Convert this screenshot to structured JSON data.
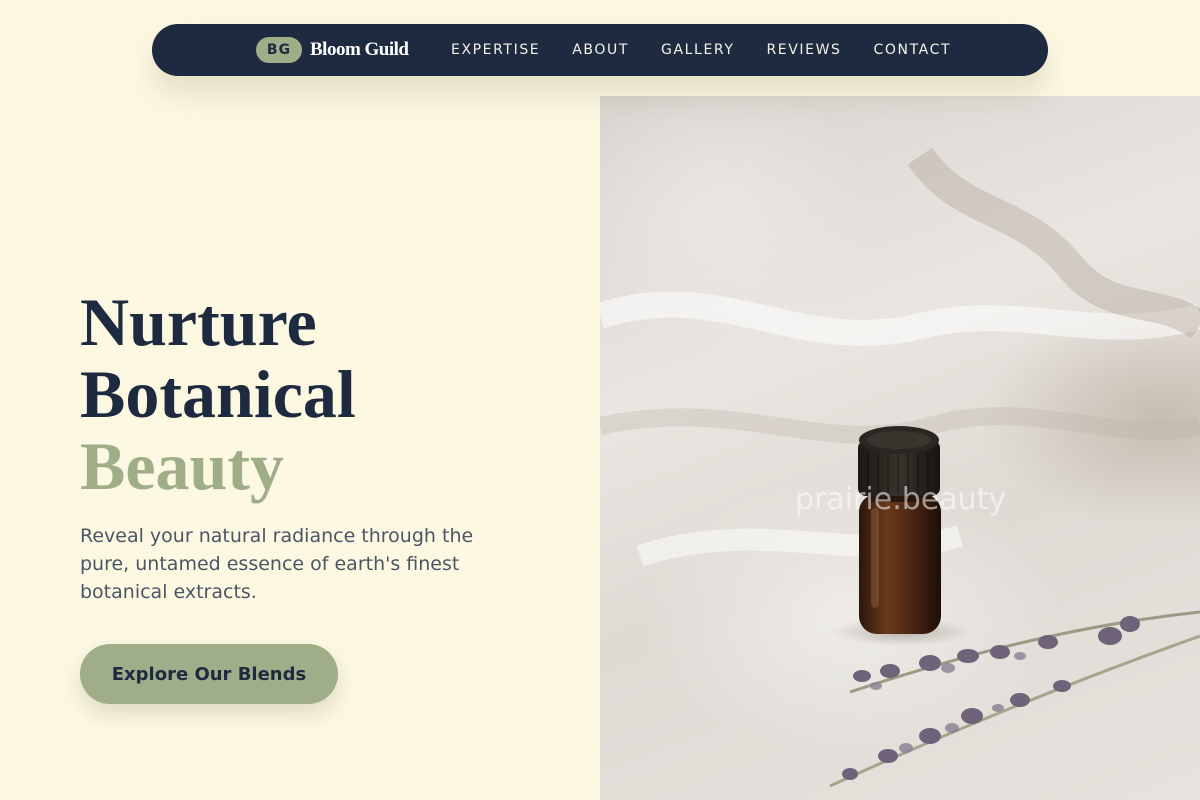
{
  "nav": {
    "brand_badge": "BG",
    "brand_name": "Bloom Guild",
    "links": [
      {
        "label": "EXPERTISE"
      },
      {
        "label": "ABOUT"
      },
      {
        "label": "GALLERY"
      },
      {
        "label": "REVIEWS"
      },
      {
        "label": "CONTACT"
      }
    ]
  },
  "hero": {
    "headline_line1": "Nurture",
    "headline_line2": "Botanical",
    "headline_accent": "Beauty",
    "subtext": "Reveal your natural radiance through the pure, untamed essence of earth's finest botanical extracts.",
    "cta_label": "Explore Our Blends"
  },
  "image": {
    "watermark": "prairie.beauty"
  },
  "colors": {
    "background": "#fdf8e2",
    "navy": "#1e2a40",
    "sage": "#9fad88",
    "body_text": "#4a5666"
  }
}
